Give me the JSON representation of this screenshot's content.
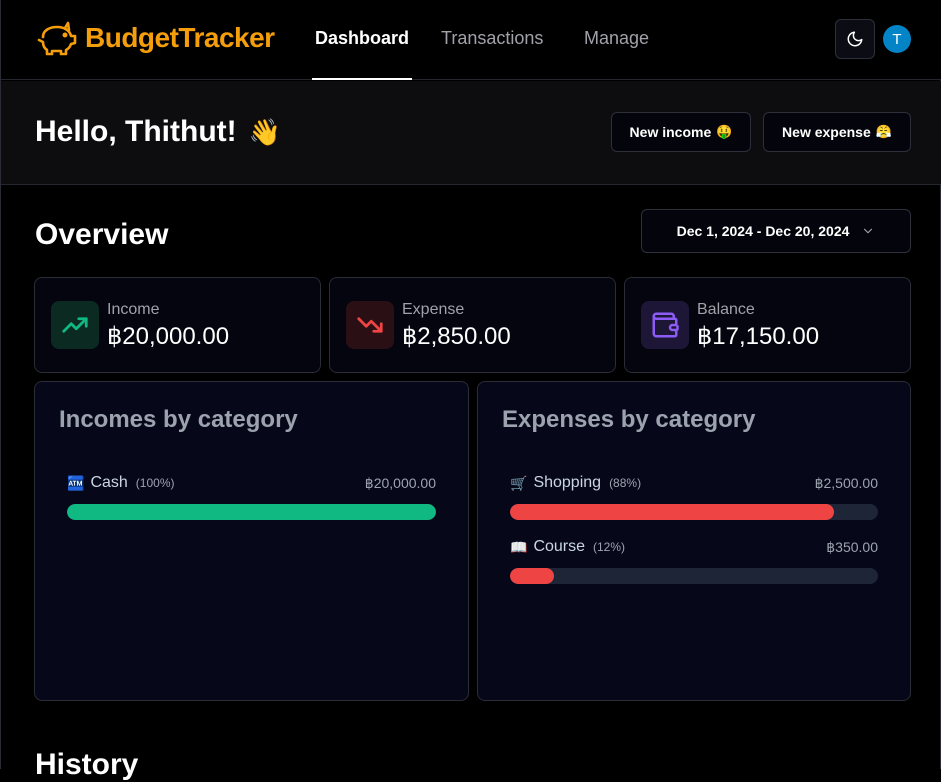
{
  "brand": {
    "name": "BudgetTracker",
    "logo_icon": "piggy-bank-icon",
    "accent": "#f59e0b"
  },
  "nav": {
    "links": [
      {
        "label": "Dashboard",
        "active": true
      },
      {
        "label": "Transactions",
        "active": false
      },
      {
        "label": "Manage",
        "active": false
      }
    ],
    "theme_icon": "moon-icon",
    "avatar_initial": "T"
  },
  "greeting": {
    "text": "Hello, Thithut!",
    "emoji": "👋"
  },
  "actions": {
    "new_income": {
      "label": "New income",
      "emoji": "🤑"
    },
    "new_expense": {
      "label": "New expense",
      "emoji": "😤"
    }
  },
  "overview": {
    "title": "Overview",
    "date_range": "Dec 1, 2024 - Dec 20, 2024",
    "stats": [
      {
        "label": "Income",
        "value": "฿20,000.00",
        "icon": "trending-up-icon",
        "color": "#10b981"
      },
      {
        "label": "Expense",
        "value": "฿2,850.00",
        "icon": "trending-down-icon",
        "color": "#ef4444"
      },
      {
        "label": "Balance",
        "value": "฿17,150.00",
        "icon": "wallet-icon",
        "color": "#8b5cf6"
      }
    ]
  },
  "incomes_by_category": {
    "title": "Incomes by category",
    "items": [
      {
        "emoji": "🏧",
        "name": "Cash",
        "percent": "(100%)",
        "amount": "฿20,000.00",
        "fraction": 1.0,
        "color": "#10b981"
      }
    ]
  },
  "expenses_by_category": {
    "title": "Expenses by category",
    "items": [
      {
        "emoji": "🛒",
        "name": "Shopping",
        "percent": "(88%)",
        "amount": "฿2,500.00",
        "fraction": 0.88,
        "color": "#ef4444"
      },
      {
        "emoji": "📖",
        "name": "Course",
        "percent": "(12%)",
        "amount": "฿350.00",
        "fraction": 0.12,
        "color": "#ef4444"
      }
    ]
  },
  "history": {
    "title": "History"
  }
}
